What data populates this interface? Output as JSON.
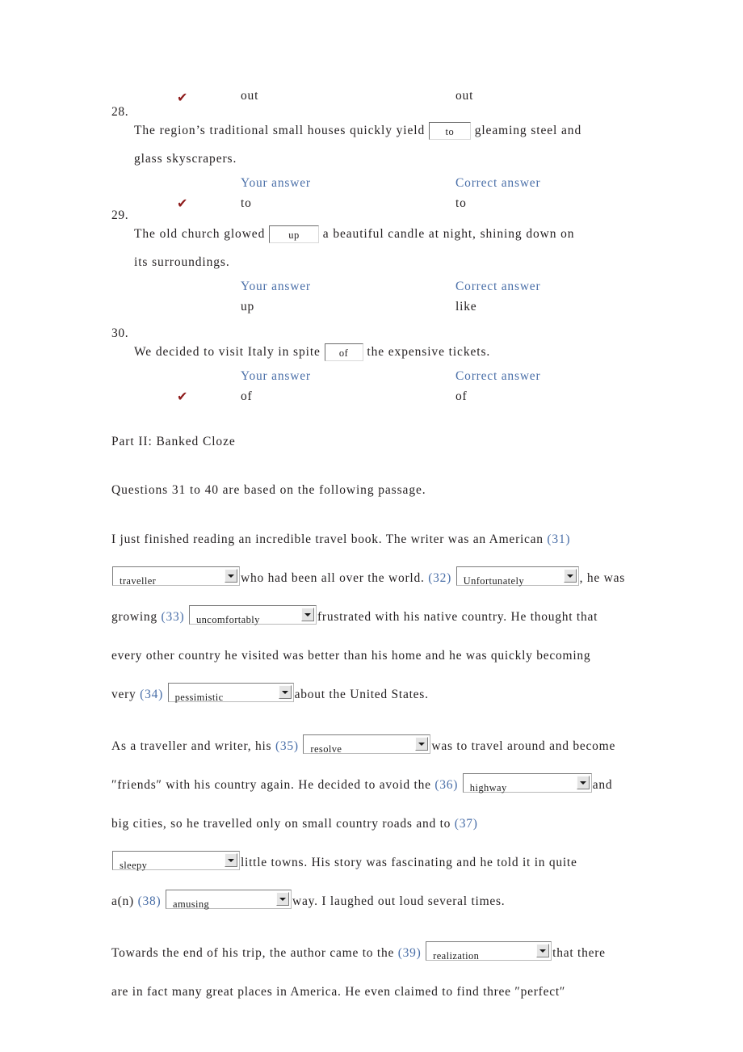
{
  "questions": [
    {
      "number": "28.",
      "top_row": {
        "check": "✔",
        "your": "out",
        "correct": "out"
      },
      "lines": [
        {
          "pre": "The region’s traditional small houses quickly yield ",
          "blank": "to",
          "post": " gleaming steel and"
        },
        {
          "pre": "glass skyscrapers.",
          "blank": null,
          "post": ""
        }
      ],
      "header_row": {
        "your": "Your answer",
        "correct": "Correct answer"
      },
      "answer_row": {
        "check": "✔",
        "your": "to",
        "correct": "to"
      }
    },
    {
      "number": "29.",
      "top_row": {
        "check": "",
        "your": "",
        "correct": ""
      },
      "lines": [
        {
          "pre": "The old church glowed ",
          "blank": "up",
          "post": " a beautiful candle at night, shining down on"
        },
        {
          "pre": "its surroundings.",
          "blank": null,
          "post": ""
        }
      ],
      "header_row": {
        "your": "Your answer",
        "correct": "Correct answer"
      },
      "answer_row": {
        "check": "",
        "your": "up",
        "correct": "like"
      }
    },
    {
      "number": "30.",
      "top_row": {
        "check": "",
        "your": "",
        "correct": ""
      },
      "lines": [
        {
          "pre": "We decided to visit Italy in spite ",
          "blank": "of",
          "post": " the expensive tickets."
        }
      ],
      "header_row": {
        "your": "Your answer",
        "correct": "Correct answer"
      },
      "answer_row": {
        "check": "✔",
        "your": "of",
        "correct": "of"
      }
    }
  ],
  "part": {
    "heading": "Part II: Banked Cloze",
    "instruction": "Questions 31 to 40 are based on the following passage."
  },
  "passage": {
    "p1": {
      "t1": "I just finished reading an incredible travel book. The writer was an American ",
      "n31": "(31)",
      "s31": "traveller",
      "t2": "who had been all over the world. ",
      "n32": "(32)",
      "s32": "Unfortunately",
      "t3": ", he was",
      "t4": "growing ",
      "n33": "(33)",
      "s33": "uncomfortably",
      "t5": "frustrated with his native country. He thought that",
      "t6": "every other country he visited was better than his home and he was quickly becoming",
      "t7": "very ",
      "n34": "(34)",
      "s34": "pessimistic",
      "t8": "about the United States."
    },
    "p2": {
      "t1": "As a traveller and writer, his ",
      "n35": "(35)",
      "s35": "resolve",
      "t2": "was to travel around and become",
      "t3": "″friends″ with his country again. He decided to avoid the ",
      "n36": "(36)",
      "s36": "highway",
      "t4": "and",
      "t5": "big cities, so he travelled only on small country roads and to ",
      "n37": "(37)",
      "s37": "sleepy",
      "t6": "little towns. His story was fascinating and he told it in quite",
      "t7": "a(n) ",
      "n38": "(38)",
      "s38": "amusing",
      "t8": "way. I laughed out loud several times."
    },
    "p3": {
      "t1": "Towards the end of his trip, the author came to the ",
      "n39": "(39)",
      "s39": "realization",
      "t2": "that there",
      "t3": "are in fact many great places in America. He even claimed to find three ″perfect″"
    }
  }
}
